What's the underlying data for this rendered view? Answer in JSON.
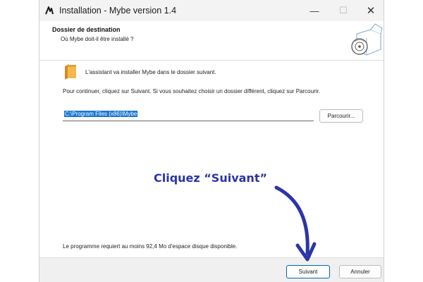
{
  "window": {
    "title": "Installation - Mybe version 1.4",
    "controls": {
      "minimize": "—",
      "maximize": "☐",
      "close": "✕"
    }
  },
  "header": {
    "title": "Dossier de destination",
    "subtitle": "Où Mybe doit-il être installé ?"
  },
  "content": {
    "intro": "L'assistant va installer Mybe dans le dossier suivant.",
    "instructions": "Pour continuer, cliquez sur Suivant. Si vous souhaitez choisir un dossier différent, cliquez sur Parcourir.",
    "path_value": "C:\\Program Files (x86)\\Mybe",
    "browse_label": "Parcourir...",
    "disk_space": "Le programme requiert au moins 92,4 Mo d'espace disque disponible."
  },
  "footer": {
    "next_label": "Suivant",
    "cancel_label": "Annuler"
  },
  "annotation": {
    "text": "Cliquez “Suivant”",
    "color": "#2b35a6"
  },
  "icons": [
    "app-logo-icon",
    "setup-box-icon",
    "folder-icon",
    "annotation-arrow-icon"
  ],
  "colors": {
    "accent": "#0067c0",
    "selection": "#1976d2",
    "annotation": "#2b35a6"
  }
}
